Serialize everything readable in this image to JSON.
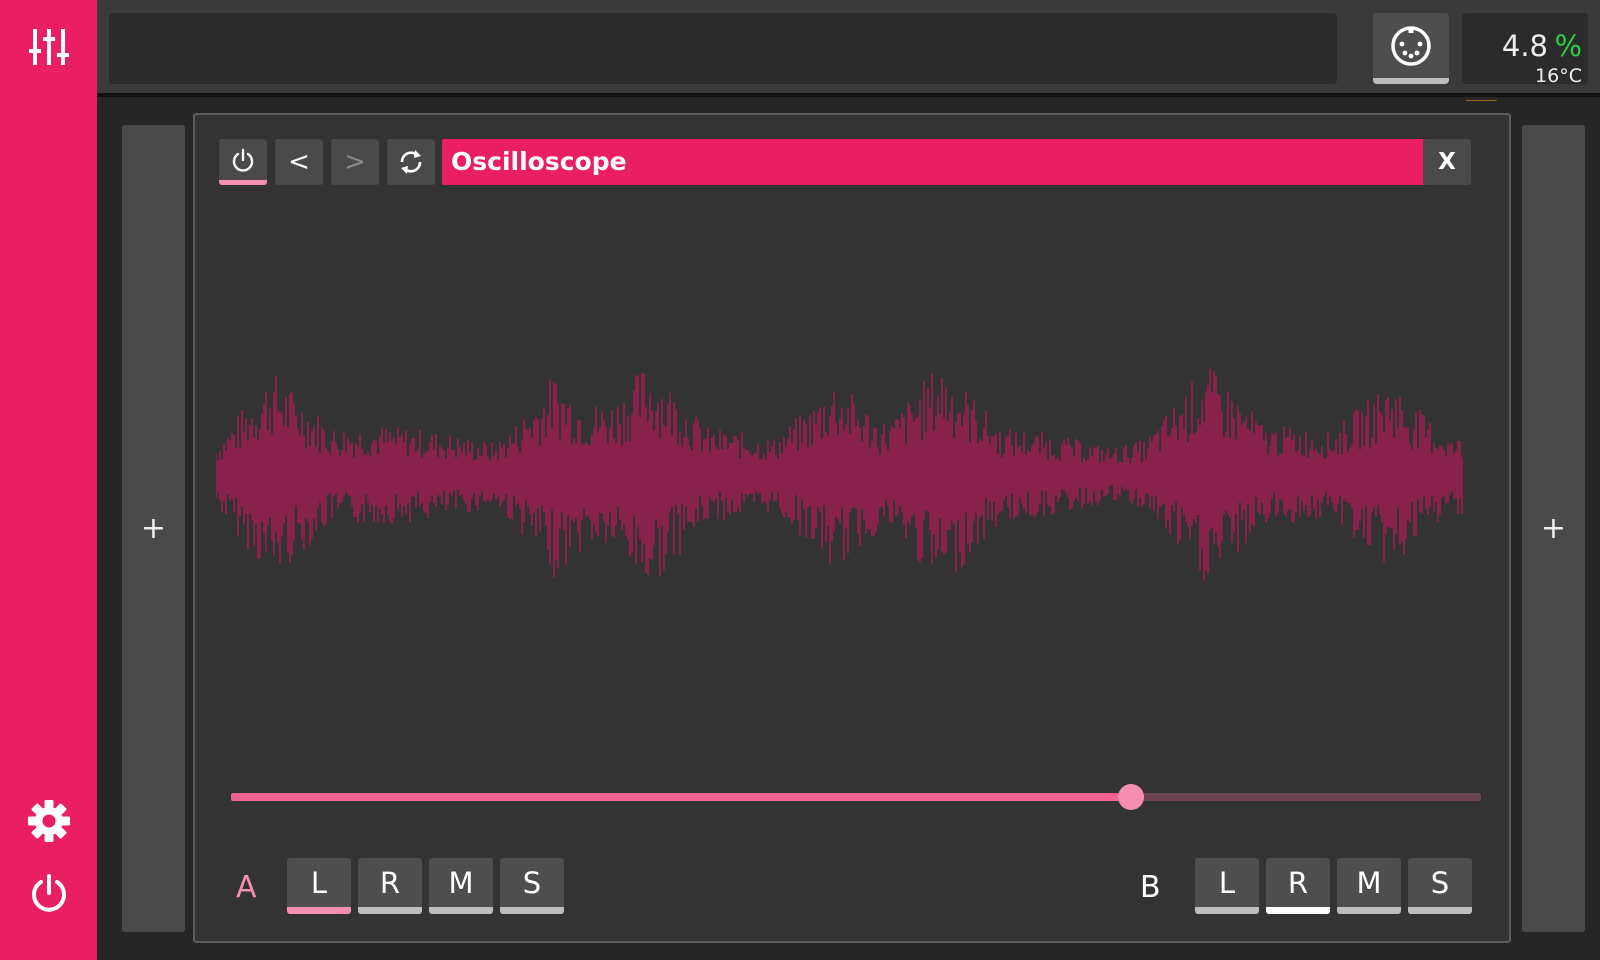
{
  "topbar": {
    "cpu_value": "4.8",
    "cpu_unit": "%",
    "temperature": "16°C",
    "xrun_indicator": "____"
  },
  "plugin": {
    "title": "Oscilloscope",
    "back_label": "<",
    "forward_label": ">",
    "close_label": "X",
    "time_slider_value_fraction": 0.72
  },
  "channels": {
    "a": {
      "label": "A",
      "buttons": [
        "L",
        "R",
        "M",
        "S"
      ],
      "active": "L"
    },
    "b": {
      "label": "B",
      "buttons": [
        "L",
        "R",
        "M",
        "S"
      ],
      "active": "R"
    }
  },
  "add_left": "+",
  "add_right": "+",
  "colors": {
    "accent": "#e91e63",
    "waveform": "#c2185b",
    "cpu_ok": "#2ecc40",
    "xrun": "#e6a100"
  }
}
